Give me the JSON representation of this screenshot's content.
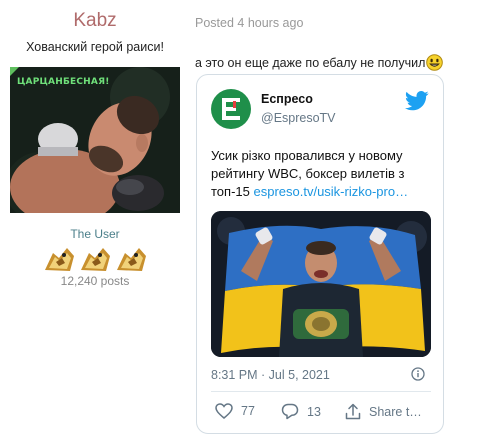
{
  "user": {
    "name": "Kabz",
    "title": "Хованский герой раиси!",
    "avatar_caption": "ЦАРЦАНБЕСНАЯ!",
    "rank": "The User",
    "rank_icon_count": 3,
    "post_count": "12,240 posts"
  },
  "post": {
    "posted": "Posted 4 hours ago",
    "text": "а это он еще даже по ебалу не получил",
    "smiley_icon": "smiley-icon"
  },
  "tweet": {
    "author_name": "Еспресо",
    "author_handle": "@EspresoTV",
    "body": "Усик різко провалився у новому рейтингу WBC, боксер вилетів з топ-15 ",
    "link": "espreso.tv/usik-rizko-pro…",
    "time": "8:31 PM · Jul 5, 2021",
    "likes": "77",
    "replies": "13",
    "share": "Share t…"
  },
  "colors": {
    "username": "#b06b6b",
    "rank": "#4b7f8a",
    "twitter_blue": "#1da1f2",
    "link": "#1b95e0",
    "espreso_green": "#1f8f4a",
    "flag_blue": "#2e6fc4",
    "flag_yellow": "#f2c21a"
  }
}
